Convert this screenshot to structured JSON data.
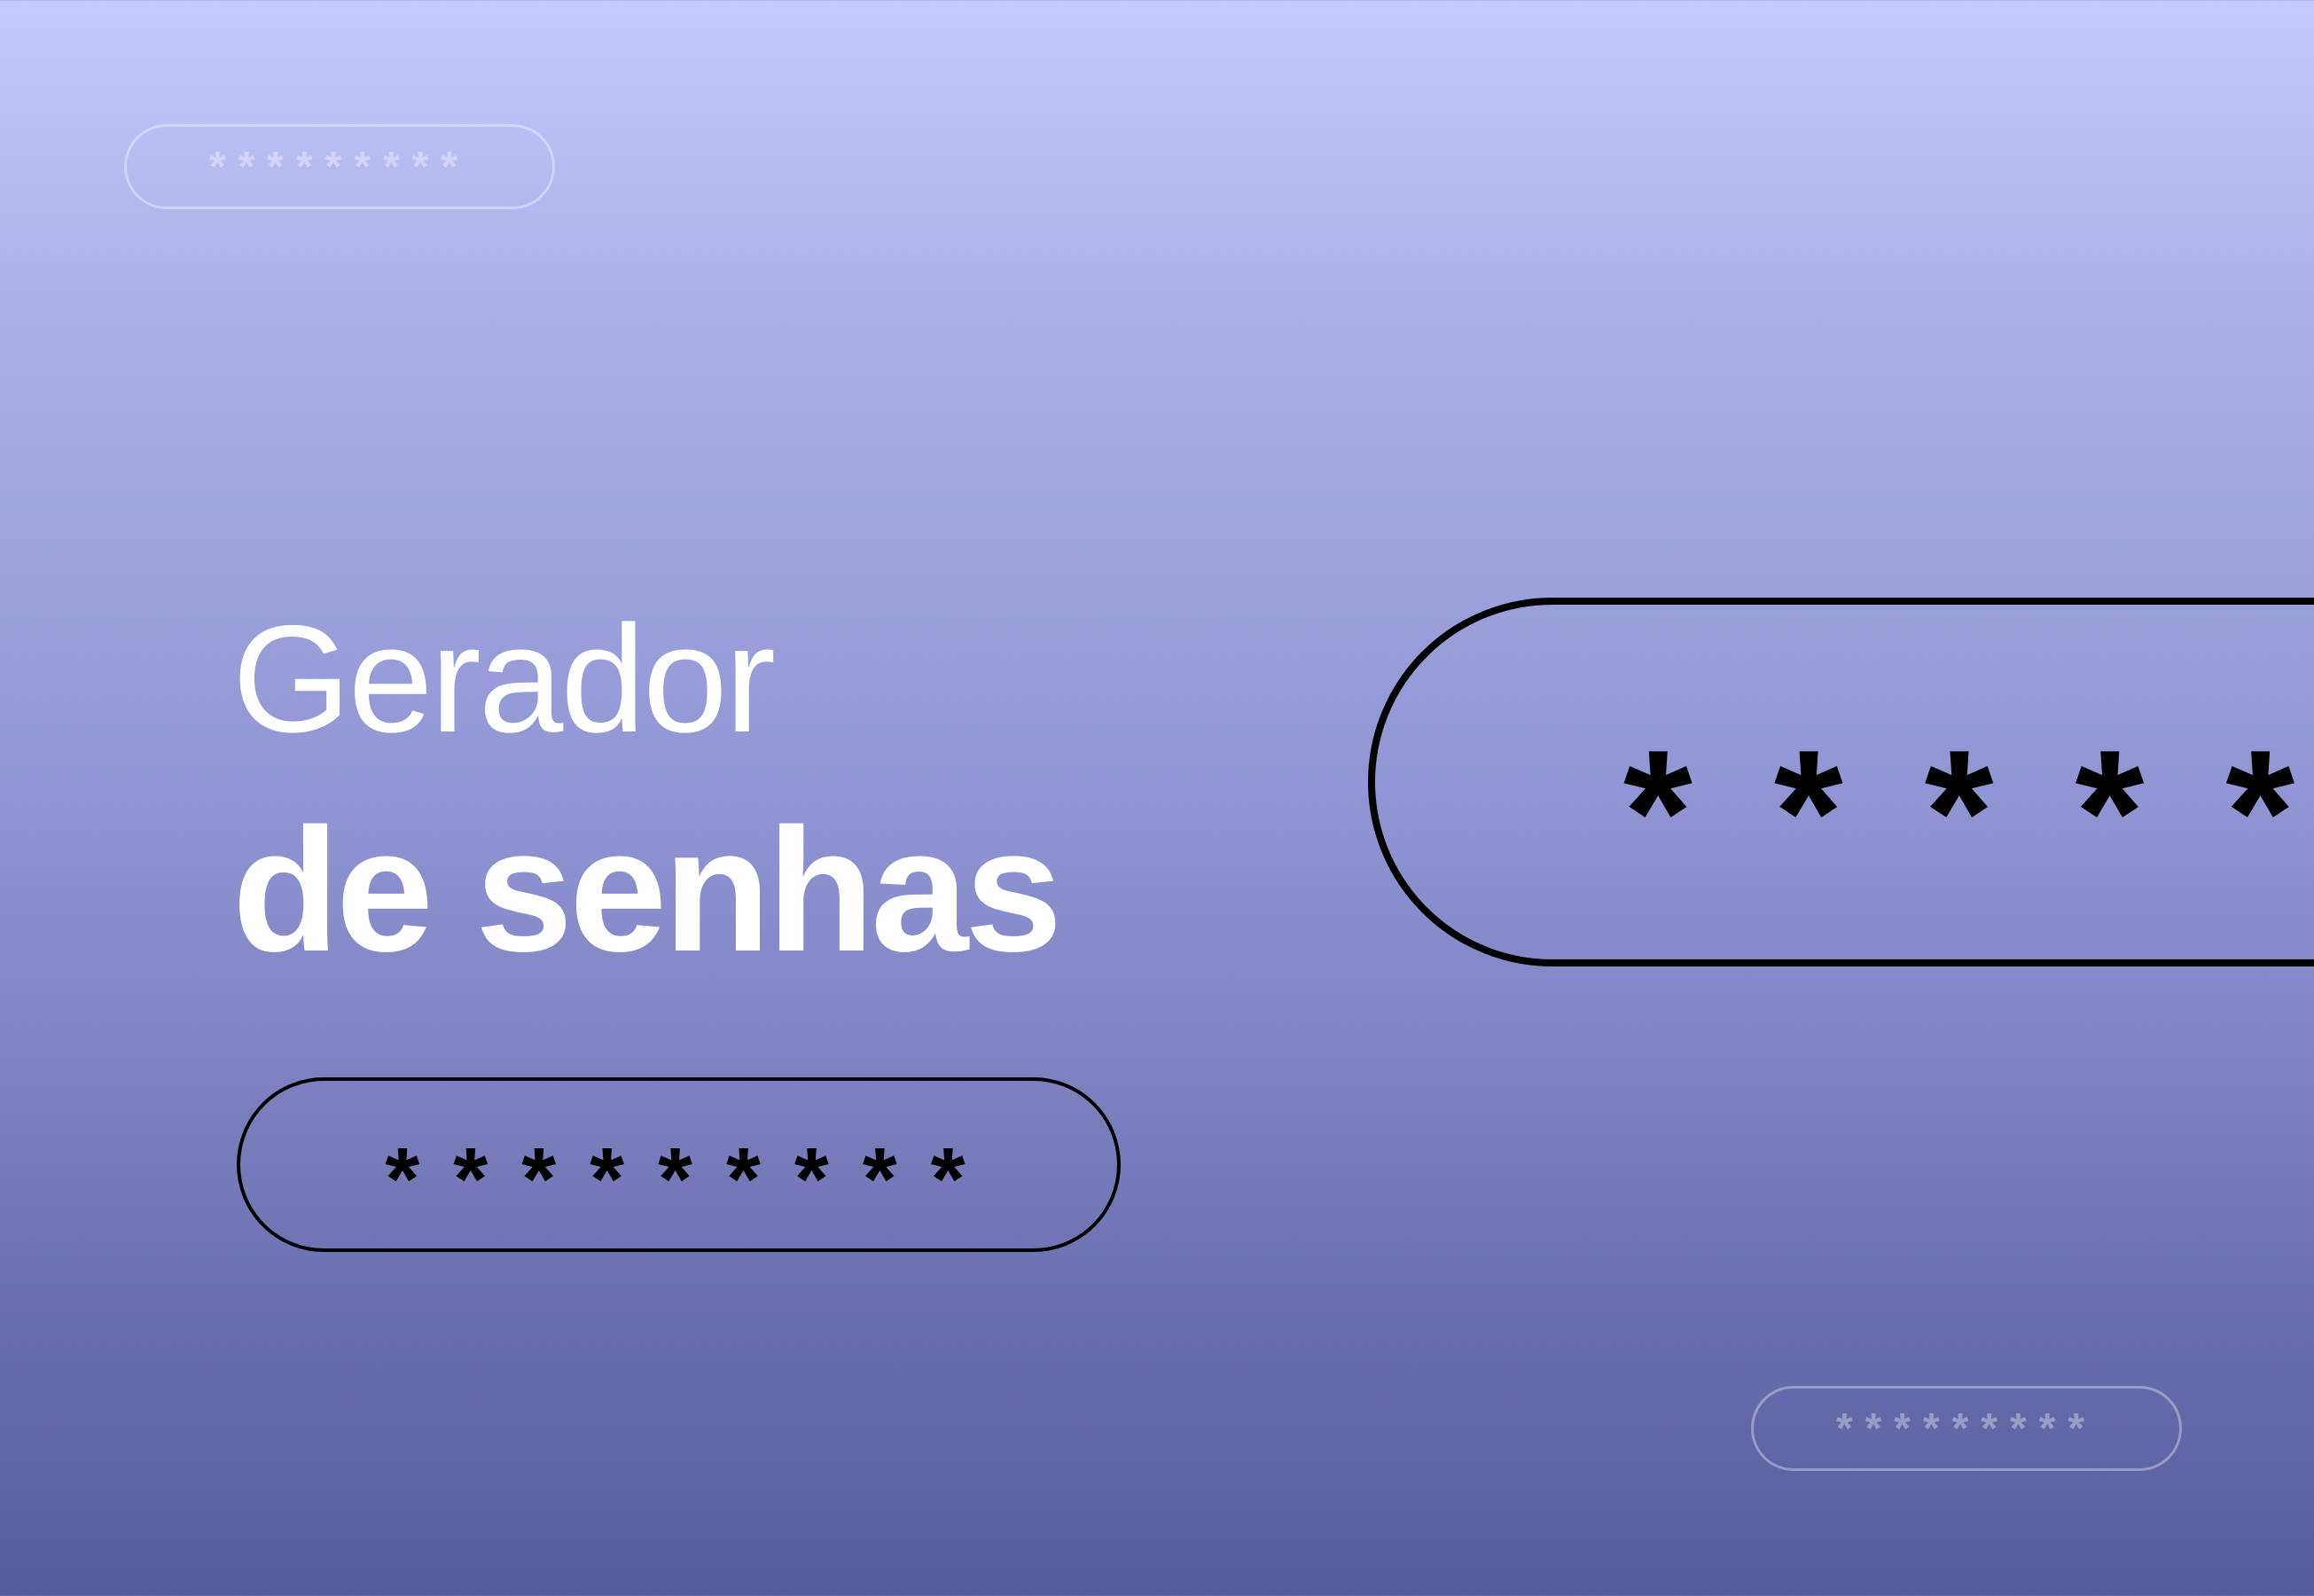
{
  "title": {
    "line1": "Gerador",
    "line2": "de senhas"
  },
  "password_fields": {
    "main_mask": "*********",
    "large_mask": "*****",
    "top_left_mask": "*********",
    "bottom_right_mask": "*********"
  },
  "colors": {
    "gradient_top": "#c3c8fd",
    "gradient_bottom": "#555c9c",
    "text": "#ffffff",
    "outline": "#000000"
  }
}
